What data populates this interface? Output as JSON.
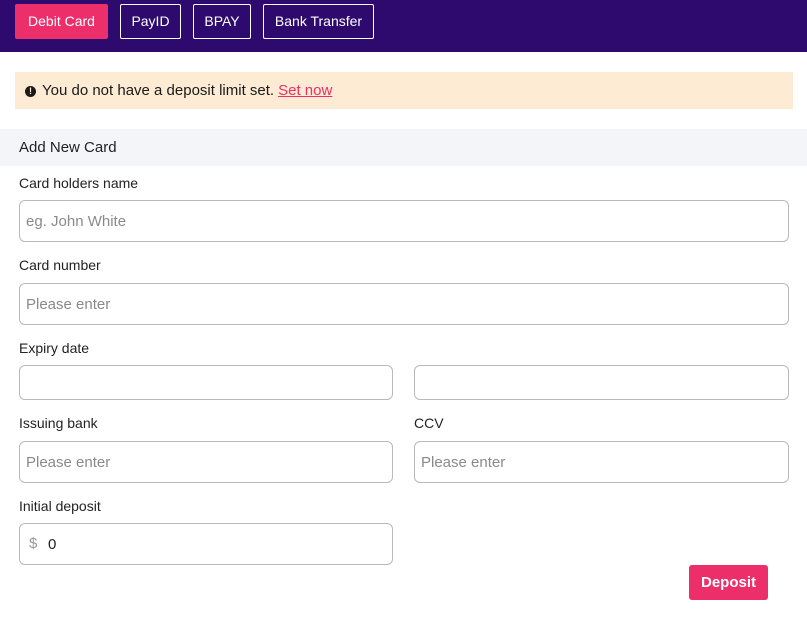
{
  "tabs": [
    {
      "label": "Debit Card",
      "active": true
    },
    {
      "label": "PayID",
      "active": false
    },
    {
      "label": "BPAY",
      "active": false
    },
    {
      "label": "Bank Transfer",
      "active": false
    }
  ],
  "alert": {
    "icon": "exclamation-circle-icon",
    "message": "You do not have a deposit limit set.",
    "link_label": "Set now"
  },
  "form": {
    "title": "Add New Card",
    "card_holder": {
      "label": "Card holders name",
      "placeholder": "eg. John White",
      "value": ""
    },
    "card_number": {
      "label": "Card number",
      "placeholder": "Please enter",
      "value": ""
    },
    "expiry": {
      "label": "Expiry date",
      "month_value": "",
      "year_value": ""
    },
    "issuing_bank": {
      "label": "Issuing bank",
      "placeholder": "Please enter",
      "value": ""
    },
    "ccv": {
      "label": "CCV",
      "placeholder": "Please enter",
      "value": ""
    },
    "initial_deposit": {
      "label": "Initial deposit",
      "currency_symbol": "$",
      "value": "0"
    },
    "submit_label": "Deposit"
  },
  "colors": {
    "header_bg": "#2e0a6e",
    "accent": "#ec2e6a",
    "alert_bg": "#fdebd3",
    "section_bg": "#f4f5f8"
  }
}
